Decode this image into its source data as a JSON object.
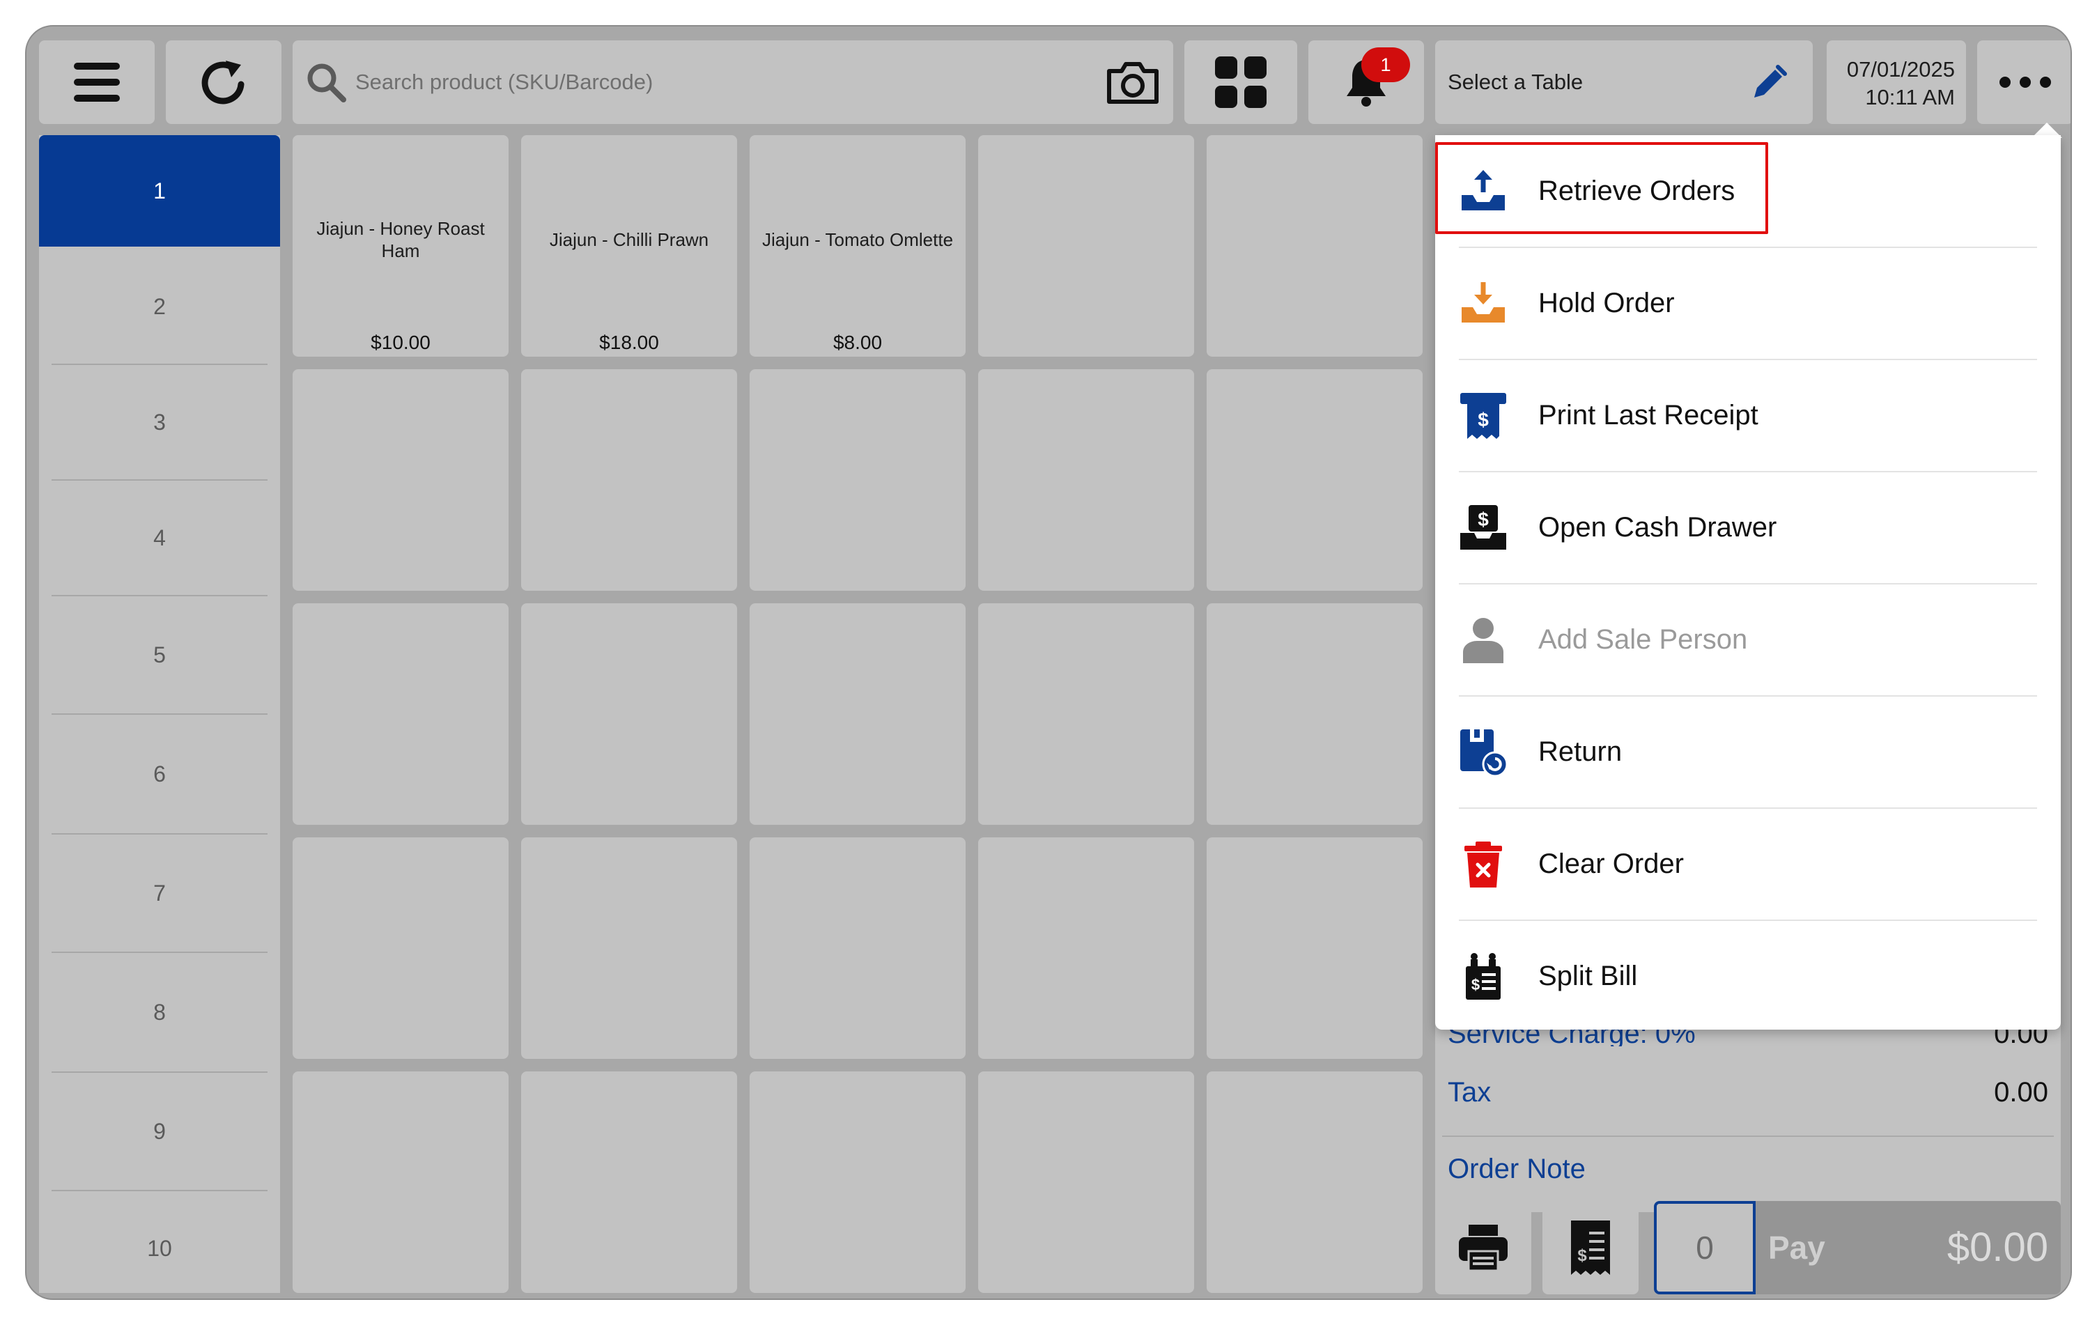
{
  "search": {
    "placeholder": "Search product (SKU/Barcode)"
  },
  "notifications": {
    "count": "1"
  },
  "table_selector": {
    "label": "Select a Table"
  },
  "datetime": {
    "date": "07/01/2025",
    "time": "10:11 AM"
  },
  "categories": [
    "1",
    "2",
    "3",
    "4",
    "5",
    "6",
    "7",
    "8",
    "9",
    "10"
  ],
  "products": [
    {
      "name": "Jiajun - Honey Roast Ham",
      "price": "$10.00"
    },
    {
      "name": "Jiajun - Chilli Prawn",
      "price": "$18.00"
    },
    {
      "name": "Jiajun - Tomato Omlette",
      "price": "$8.00"
    }
  ],
  "menu": {
    "items": [
      {
        "label": "Retrieve Orders",
        "icon": "inbox-upload-icon",
        "enabled": true,
        "highlighted": true
      },
      {
        "label": "Hold Order",
        "icon": "inbox-download-icon",
        "enabled": true
      },
      {
        "label": "Print Last Receipt",
        "icon": "receipt-dollar-icon",
        "enabled": true
      },
      {
        "label": "Open Cash Drawer",
        "icon": "cash-drawer-icon",
        "enabled": true
      },
      {
        "label": "Add Sale Person",
        "icon": "person-icon",
        "enabled": false
      },
      {
        "label": "Return",
        "icon": "return-box-icon",
        "enabled": true
      },
      {
        "label": "Clear Order",
        "icon": "trash-icon",
        "enabled": true
      },
      {
        "label": "Split Bill",
        "icon": "split-bill-icon",
        "enabled": true
      }
    ]
  },
  "summary": {
    "service_charge_label": "Service Charge: 0%",
    "service_charge_value": "0.00",
    "tax_label": "Tax",
    "tax_value": "0.00",
    "order_note_label": "Order Note"
  },
  "checkout": {
    "quantity": "0",
    "pay_label": "Pay",
    "total": "$0.00"
  },
  "colors": {
    "primary": "#063a93",
    "link": "#0d3f93",
    "alert": "#d10d0d",
    "hold": "#e8892b",
    "panel": "#c2c2c2",
    "background": "#a8a8a8"
  }
}
